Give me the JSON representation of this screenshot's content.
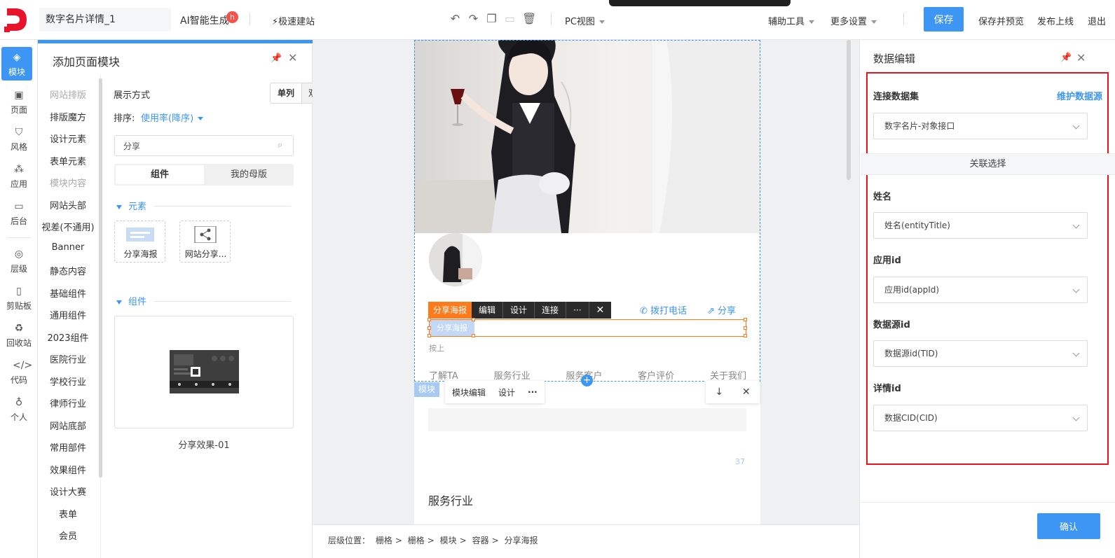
{
  "topbar": {
    "page_name": "数字名片详情_1",
    "ai_gen": "AI智能生成",
    "ai_badge": "h",
    "fast_build": "极速建站",
    "pc_view": "PC视图",
    "aux_tools": "辅助工具",
    "more_settings": "更多设置",
    "save": "保存",
    "save_preview": "保存并预览",
    "publish": "发布上线",
    "logout": "退出"
  },
  "leftnav": {
    "items": [
      {
        "label": "模块",
        "icon": "layers-icon"
      },
      {
        "label": "页面",
        "icon": "page-icon"
      },
      {
        "label": "风格",
        "icon": "shirt-icon"
      },
      {
        "label": "应用",
        "icon": "apps-icon"
      },
      {
        "label": "后台",
        "icon": "monitor-icon"
      },
      {
        "label": "层级",
        "icon": "location-icon"
      },
      {
        "label": "剪贴板",
        "icon": "clipboard-icon"
      },
      {
        "label": "回收站",
        "icon": "recycle-icon"
      },
      {
        "label": "代码",
        "icon": "code-icon"
      },
      {
        "label": "个人",
        "icon": "bulb-icon"
      }
    ]
  },
  "module_panel": {
    "title": "添加页面模块",
    "categories": [
      "网站排版",
      "排版魔方",
      "设计元素",
      "表单元素",
      "模块内容",
      "网站头部",
      "视差(不通用)",
      "Banner",
      "静态内容",
      "基础组件",
      "通用组件",
      "2023组件",
      "医院行业",
      "学校行业",
      "律师行业",
      "网站底部",
      "常用部件",
      "效果组件",
      "设计大赛",
      "表单",
      "会员"
    ],
    "display_label": "展示方式",
    "single": "单列",
    "double": "双列",
    "sort_label": "排序:",
    "sort_value": "使用率(降序)",
    "search_value": "分享",
    "tab_components": "组件",
    "tab_masters": "我的母版",
    "section_elements": "元素",
    "section_components": "组件",
    "elements": [
      {
        "label": "分享海报",
        "icon": "poster-icon"
      },
      {
        "label": "网站分享...",
        "icon": "share-nodes-icon"
      }
    ],
    "component_label": "分享效果-01"
  },
  "canvas": {
    "toolbar_tag": "分享海报",
    "toolbar_items": [
      "编辑",
      "设计",
      "连接",
      "···"
    ],
    "call": "拨打电话",
    "share": "分享",
    "selected_placeholder": "分享海报",
    "press_text": "按上",
    "nav_items": [
      "了解TA",
      "服务行业",
      "服务客户",
      "客户评价",
      "关于我们"
    ],
    "module_tag": "模块",
    "module_edit": "模块编辑",
    "module_design": "设计",
    "module_more": "···",
    "count": "37",
    "section_title": "服务行业"
  },
  "breadcrumb": {
    "prefix": "层级位置：",
    "items": [
      "栅格",
      "栅格",
      "模块",
      "容器",
      "分享海报"
    ]
  },
  "right_panel": {
    "title": "数据编辑",
    "dataset_label": "连接数据集",
    "maintain_link": "维护数据源",
    "dataset_value": "数字名片-对象接口",
    "assoc_label": "关联选择",
    "fields": [
      {
        "label": "姓名",
        "value": "姓名(entityTitle)"
      },
      {
        "label": "应用id",
        "value": "应用id(appId)"
      },
      {
        "label": "数据源id",
        "value": "数据源id(TID)"
      },
      {
        "label": "详情id",
        "value": "数据CID(CID)"
      }
    ],
    "confirm": "确认"
  },
  "colors": {
    "accent": "#3d95f4",
    "highlight": "#e8141c",
    "selection": "#ff7a1a",
    "brand": "#e8142c"
  }
}
